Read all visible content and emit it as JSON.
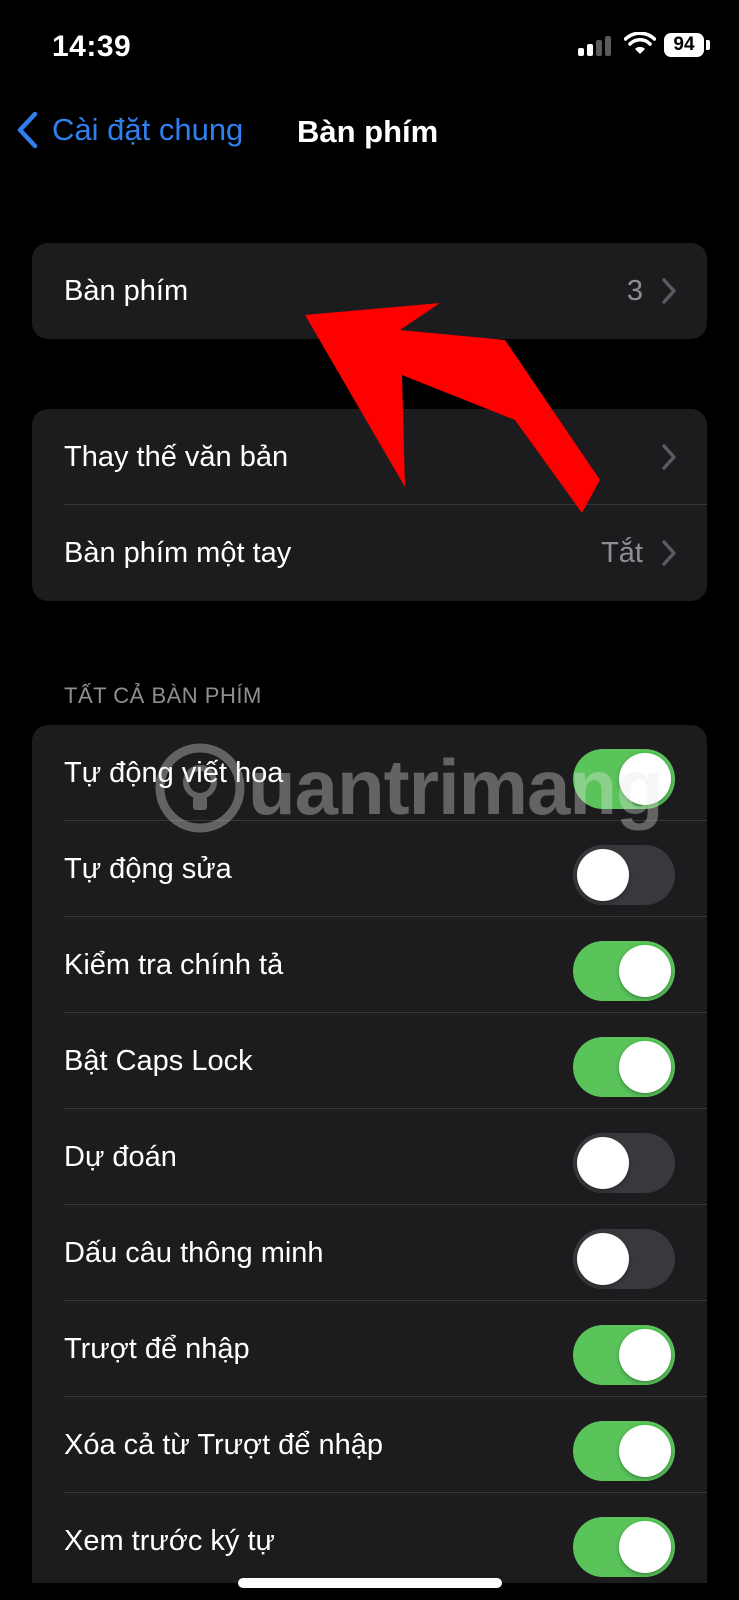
{
  "status_bar": {
    "time": "14:39",
    "battery": "94",
    "icons": [
      "signal-icon",
      "wifi-icon",
      "battery-icon"
    ]
  },
  "nav": {
    "back_label": "Cài đặt chung",
    "title": "Bàn phím"
  },
  "keyboards_group": {
    "label": "Bàn phím",
    "value": "3"
  },
  "text_group": {
    "items": [
      {
        "label": "Thay thế văn bản",
        "value": ""
      },
      {
        "label": "Bàn phím một tay",
        "value": "Tắt"
      }
    ]
  },
  "all_keyboards": {
    "header": "TẤT CẢ BÀN PHÍM",
    "items": [
      {
        "label": "Tự động viết hoa",
        "on": true
      },
      {
        "label": "Tự động sửa",
        "on": false
      },
      {
        "label": "Kiểm tra chính tả",
        "on": true
      },
      {
        "label": "Bật Caps Lock",
        "on": true
      },
      {
        "label": "Dự đoán",
        "on": false
      },
      {
        "label": "Dấu câu thông minh",
        "on": false
      },
      {
        "label": "Trượt để nhập",
        "on": true
      },
      {
        "label": "Xóa cả từ Trượt để nhập",
        "on": true
      },
      {
        "label": "Xem trước ký tự",
        "on": true
      }
    ]
  },
  "watermark": "uantrimang",
  "colors": {
    "accent_blue": "#2f80ed",
    "toggle_on": "#5ac35a",
    "toggle_off": "#39393d",
    "annotation_arrow": "#ff0000"
  }
}
